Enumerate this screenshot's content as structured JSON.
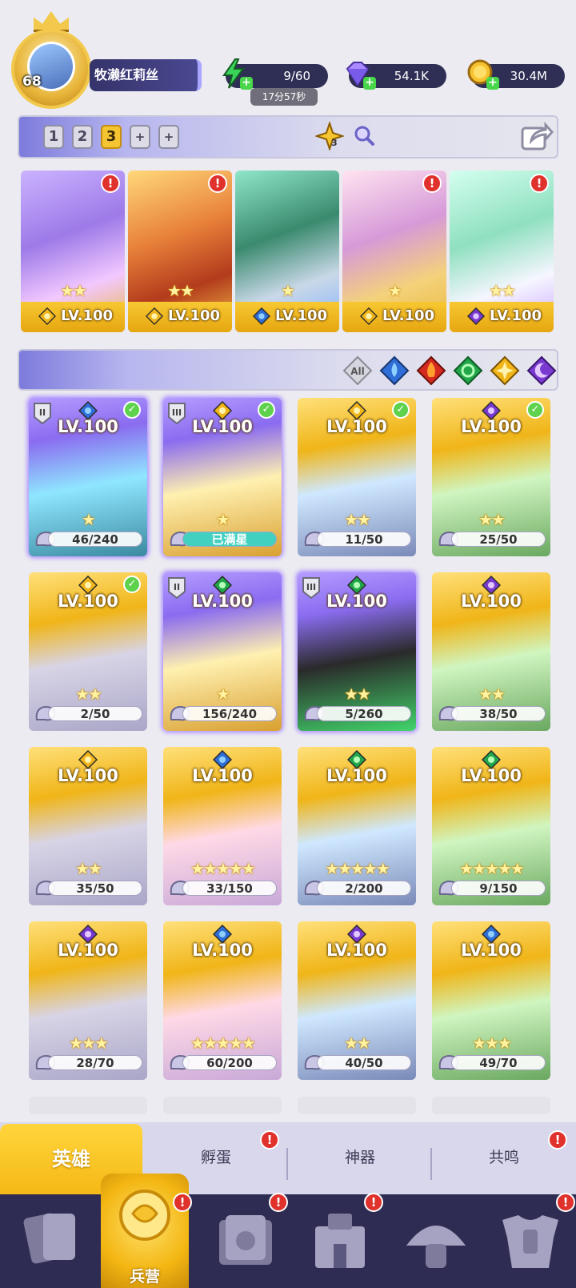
{
  "player": {
    "level": "68",
    "name": "牧濑红莉丝"
  },
  "resources": {
    "energy": "9/60",
    "energy_timer": "17分57秒",
    "gems": "54.1K",
    "gold": "30.4M"
  },
  "team_tabs": [
    "1",
    "2",
    "3",
    "+",
    "+"
  ],
  "team_active_index": 2,
  "team_power_badge": "3",
  "team_heroes": [
    {
      "level": "LV.100",
      "element": "light",
      "stars": 2,
      "alert": "!"
    },
    {
      "level": "LV.100",
      "element": "light",
      "stars": 2,
      "alert": "!"
    },
    {
      "level": "LV.100",
      "element": "water",
      "stars": 1,
      "alert": ""
    },
    {
      "level": "LV.100",
      "element": "light",
      "stars": 1,
      "alert": "!"
    },
    {
      "level": "LV.100",
      "element": "dark",
      "stars": 2,
      "alert": "!"
    }
  ],
  "filters": [
    {
      "label": "All",
      "icon": "all-icon"
    },
    {
      "label": "",
      "icon": "water-element-icon"
    },
    {
      "label": "",
      "icon": "fire-element-icon"
    },
    {
      "label": "",
      "icon": "wind-element-icon"
    },
    {
      "label": "",
      "icon": "light-element-icon"
    },
    {
      "label": "",
      "icon": "dark-element-icon"
    }
  ],
  "hero_cards": [
    {
      "level": "LV.100",
      "element": "water",
      "progress": "46/240",
      "rarity": "purple",
      "checked": true,
      "rank": "II",
      "stars": 1
    },
    {
      "level": "LV.100",
      "element": "light",
      "progress": "已满星",
      "rarity": "purple",
      "checked": true,
      "rank": "III",
      "stars": 1
    },
    {
      "level": "LV.100",
      "element": "light",
      "progress": "11/50",
      "rarity": "gold",
      "checked": true,
      "rank": "",
      "stars": 2
    },
    {
      "level": "LV.100",
      "element": "dark",
      "progress": "25/50",
      "rarity": "gold",
      "checked": true,
      "rank": "",
      "stars": 2
    },
    {
      "level": "LV.100",
      "element": "light",
      "progress": "2/50",
      "rarity": "gold",
      "checked": true,
      "rank": "",
      "stars": 2
    },
    {
      "level": "LV.100",
      "element": "wind",
      "progress": "156/240",
      "rarity": "purple",
      "checked": false,
      "rank": "II",
      "stars": 1
    },
    {
      "level": "LV.100",
      "element": "wind",
      "progress": "5/260",
      "rarity": "purple",
      "checked": false,
      "rank": "III",
      "stars": 2
    },
    {
      "level": "LV.100",
      "element": "dark",
      "progress": "38/50",
      "rarity": "gold",
      "checked": false,
      "rank": "",
      "stars": 2
    },
    {
      "level": "LV.100",
      "element": "light",
      "progress": "35/50",
      "rarity": "gold",
      "checked": false,
      "rank": "",
      "stars": 2
    },
    {
      "level": "LV.100",
      "element": "water",
      "progress": "33/150",
      "rarity": "gold",
      "checked": false,
      "rank": "",
      "stars": 5
    },
    {
      "level": "LV.100",
      "element": "wind",
      "progress": "2/200",
      "rarity": "gold",
      "checked": false,
      "rank": "",
      "stars": 5
    },
    {
      "level": "LV.100",
      "element": "wind",
      "progress": "9/150",
      "rarity": "gold",
      "checked": false,
      "rank": "",
      "stars": 5
    },
    {
      "level": "LV.100",
      "element": "dark",
      "progress": "28/70",
      "rarity": "gold",
      "checked": false,
      "rank": "",
      "stars": 3
    },
    {
      "level": "LV.100",
      "element": "water",
      "progress": "60/200",
      "rarity": "gold",
      "checked": false,
      "rank": "",
      "stars": 5
    },
    {
      "level": "LV.100",
      "element": "dark",
      "progress": "40/50",
      "rarity": "gold",
      "checked": false,
      "rank": "",
      "stars": 2
    },
    {
      "level": "LV.100",
      "element": "water",
      "progress": "49/70",
      "rarity": "gold",
      "checked": false,
      "rank": "",
      "stars": 3
    }
  ],
  "sub_tabs": {
    "hero": "英雄",
    "hatch": "孵蛋",
    "artifact": "神器",
    "resonance": "共鸣"
  },
  "nav": {
    "barracks": "兵营"
  },
  "colors": {
    "gold": "#f3b612",
    "purple": "#8a6cf0",
    "nav_bg": "#2e2c52",
    "alert": "#e0312c"
  }
}
